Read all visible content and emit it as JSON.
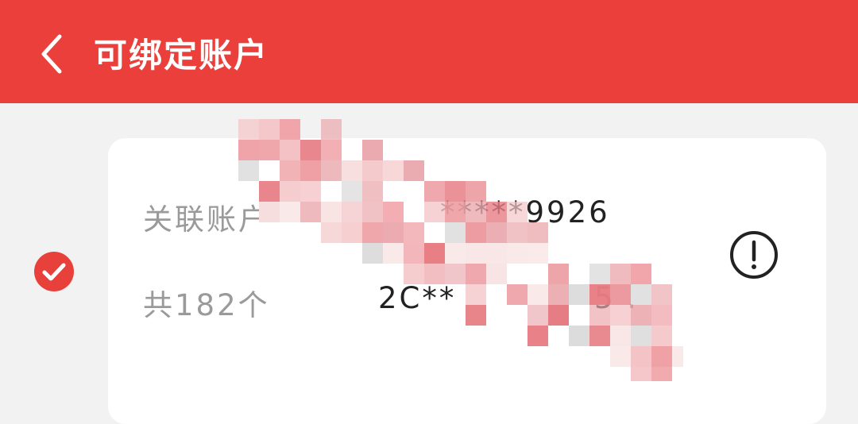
{
  "header": {
    "title": "可绑定账户",
    "back_icon": "chevron-left-icon",
    "bg_color": "#ea3f3a"
  },
  "account": {
    "selected": true,
    "check_icon": "checkmark-circle-icon",
    "label": "关联账户",
    "value": "*****9926",
    "count_label": "共182个",
    "code_value": "2C**",
    "code_suffix": "5 .",
    "info_icon": "exclamation-circle-icon"
  }
}
